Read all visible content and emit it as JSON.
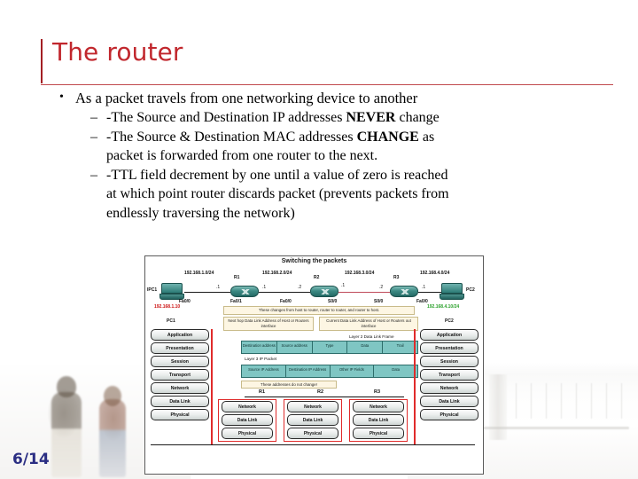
{
  "slide": {
    "title": "The router",
    "page_number": "6/14",
    "accent_color": "#C1272D",
    "rule_color": "#A31F24",
    "page_number_color": "#2B2E83"
  },
  "bullets": [
    {
      "level": 1,
      "marker": "•",
      "text": "As a packet travels from one networking device to another"
    },
    {
      "level": 2,
      "marker": "–",
      "parts": [
        {
          "text": "-The Source and Destination IP addresses ",
          "bold": false
        },
        {
          "text": "NEVER",
          "bold": true
        },
        {
          "text": " change",
          "bold": false
        }
      ]
    },
    {
      "level": 2,
      "marker": "–",
      "parts": [
        {
          "text": "-The Source & Destination MAC addresses ",
          "bold": false
        },
        {
          "text": "CHANGE",
          "bold": true
        },
        {
          "text": " as",
          "bold": false
        }
      ],
      "continuation": "packet is forwarded from one router to the next."
    },
    {
      "level": 2,
      "marker": "–",
      "parts": [
        {
          "text": "-TTL field decrement by one until a value of zero is reached",
          "bold": false
        }
      ],
      "continuation2": "at which point router discards packet (prevents packets from",
      "continuation3": "endlessly traversing the network)"
    }
  ],
  "diagram": {
    "title": "Switching the packets",
    "endpoints": [
      {
        "name": "PC1",
        "label_left": "IPC1",
        "caption": "PC1",
        "ip": "192.168.1.10",
        "ip_color": "#cc1111"
      },
      {
        "name": "PC2",
        "label_right": "PC2",
        "caption": "PC2",
        "ip": "192.168.4.10/24",
        "ip_color": "#2aa02a"
      }
    ],
    "routers": [
      {
        "name": "R1",
        "left_if": "Fa0/0",
        "right_if": "Fa0/1",
        "left_num": ".1",
        "right_num": ".1"
      },
      {
        "name": "R2",
        "left_if": "Fa0/0",
        "right_if": "S0/0",
        "left_num": ".2",
        "right_num": ".1"
      },
      {
        "name": "R3",
        "left_if": "S0/0",
        "right_if": "Fa0/0",
        "left_num": ".2",
        "right_num": ".1"
      }
    ],
    "networks": [
      "192.168.1.0/24",
      "192.168.2.0/24",
      "192.168.3.0/24",
      "192.168.4.0/24"
    ],
    "interface_labels": [
      "Fa0/0",
      "Fa0/1",
      "Fa0/0",
      "S0/0",
      "S0/0",
      "Fa0/0"
    ],
    "notes": {
      "changes": "These changes from host to router, router to router, and router to host.",
      "next_hop": "Next hop Data Link Address of Host or Routers interface",
      "current": "Current Data Link Address of Host or Routers out interface",
      "no_change": "These addresses do not change!",
      "frame_caption": "Layer 2 Data Link Frame",
      "packet_caption": "Layer 3 IP Packet"
    },
    "frame_fields": [
      "Destination address",
      "Source address",
      "Type",
      "Data",
      "Trail"
    ],
    "packet_fields": [
      "Source IP Address",
      "Destination IP Address",
      "Other IP Fields",
      "Data"
    ],
    "osi_layers": [
      "Application",
      "Presentation",
      "Session",
      "Transport",
      "Network",
      "Data Link",
      "Physical"
    ],
    "router_osi_layers": [
      "Network",
      "Data Link",
      "Physical"
    ],
    "router_span_labels": [
      "R1",
      "R2",
      "R3"
    ]
  }
}
